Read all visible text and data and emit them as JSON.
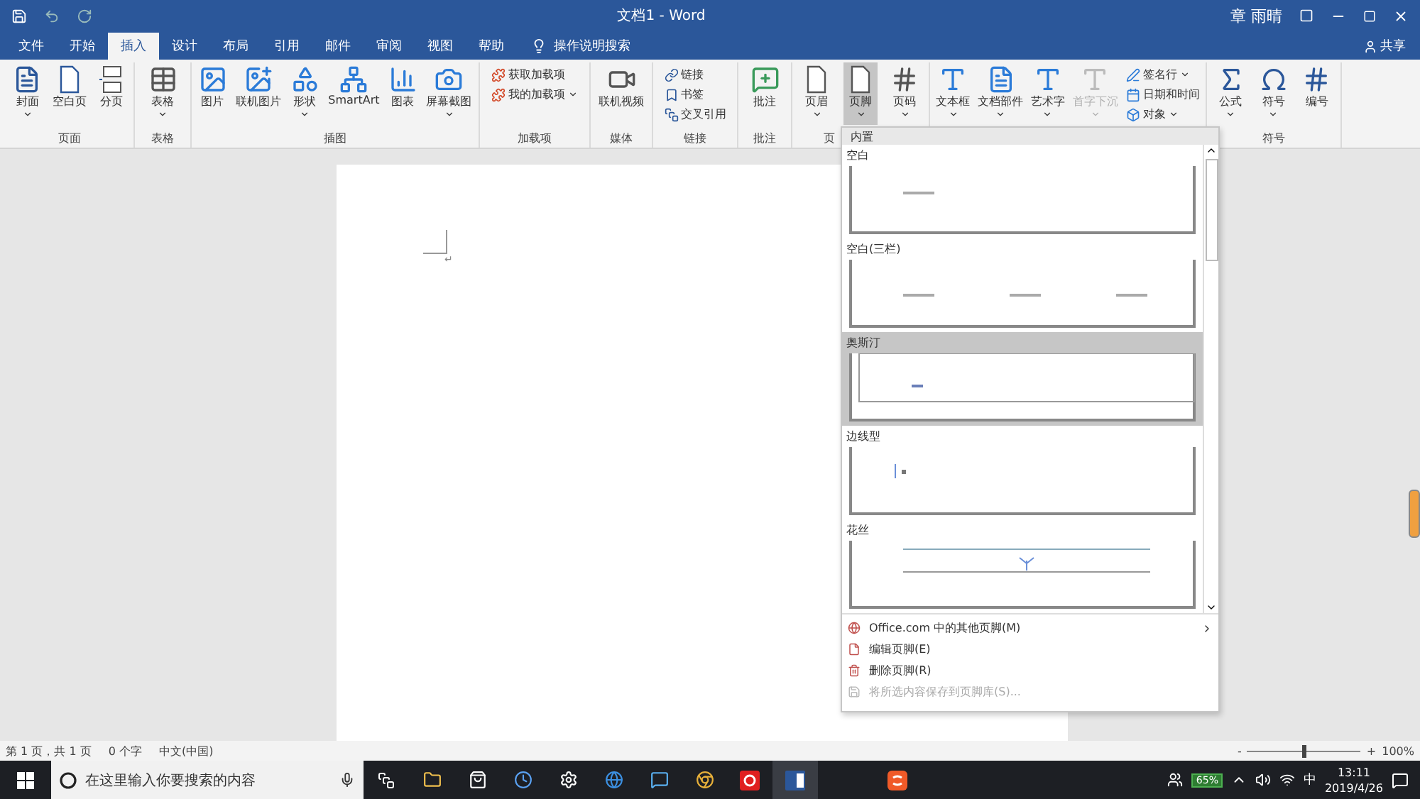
{
  "window": {
    "title": "文档1 - Word",
    "user": "章 雨晴",
    "share": "共享"
  },
  "tabs": [
    {
      "label": "文件",
      "selected": false
    },
    {
      "label": "开始",
      "selected": false
    },
    {
      "label": "插入",
      "selected": true
    },
    {
      "label": "设计",
      "selected": false
    },
    {
      "label": "布局",
      "selected": false
    },
    {
      "label": "引用",
      "selected": false
    },
    {
      "label": "邮件",
      "selected": false
    },
    {
      "label": "审阅",
      "selected": false
    },
    {
      "label": "视图",
      "selected": false
    },
    {
      "label": "帮助",
      "selected": false
    }
  ],
  "tell_me": "操作说明搜索",
  "ribbon": {
    "groups": [
      {
        "label": "页面",
        "buttons": [
          {
            "label": "封面",
            "kind": "large",
            "dropdown": true
          },
          {
            "label": "空白页",
            "kind": "large",
            "dropdown": false
          },
          {
            "label": "分页",
            "kind": "large",
            "dropdown": false
          }
        ]
      },
      {
        "label": "表格",
        "buttons": [
          {
            "label": "表格",
            "kind": "large",
            "dropdown": true
          }
        ]
      },
      {
        "label": "插图",
        "buttons": [
          {
            "label": "图片",
            "kind": "large",
            "dropdown": false
          },
          {
            "label": "联机图片",
            "kind": "large",
            "dropdown": false
          },
          {
            "label": "形状",
            "kind": "large",
            "dropdown": true
          },
          {
            "label": "SmartArt",
            "kind": "large",
            "dropdown": false
          },
          {
            "label": "图表",
            "kind": "large",
            "dropdown": false
          },
          {
            "label": "屏幕截图",
            "kind": "large",
            "dropdown": true
          }
        ]
      },
      {
        "label": "加载项",
        "buttons": [
          {
            "label": "获取加载项",
            "kind": "small",
            "dropdown": false
          },
          {
            "label": "我的加载项",
            "kind": "small",
            "dropdown": true
          }
        ]
      },
      {
        "label": "媒体",
        "buttons": [
          {
            "label": "联机视频",
            "kind": "large",
            "dropdown": false
          }
        ]
      },
      {
        "label": "链接",
        "buttons": [
          {
            "label": "链接",
            "kind": "small",
            "dropdown": false
          },
          {
            "label": "书签",
            "kind": "small",
            "dropdown": false
          },
          {
            "label": "交叉引用",
            "kind": "small",
            "dropdown": false
          }
        ]
      },
      {
        "label": "批注",
        "buttons": [
          {
            "label": "批注",
            "kind": "large",
            "dropdown": false
          }
        ]
      },
      {
        "label": "页",
        "buttons": [
          {
            "label": "页眉",
            "kind": "large",
            "dropdown": true,
            "selected": false
          },
          {
            "label": "页脚",
            "kind": "large",
            "dropdown": true,
            "selected": true
          },
          {
            "label": "页码",
            "kind": "large",
            "dropdown": true,
            "selected": false
          }
        ]
      },
      {
        "buttons": [
          {
            "label": "文本框",
            "kind": "large",
            "dropdown": true,
            "disabled": false
          },
          {
            "label": "文档部件",
            "kind": "large",
            "dropdown": true,
            "disabled": false
          },
          {
            "label": "艺术字",
            "kind": "large",
            "dropdown": true,
            "disabled": false
          },
          {
            "label": "首字下沉",
            "kind": "large",
            "dropdown": true,
            "disabled": true
          },
          {
            "label": "签名行",
            "kind": "small",
            "dropdown": true,
            "disabled": false
          },
          {
            "label": "日期和时间",
            "kind": "small",
            "dropdown": false,
            "disabled": false
          },
          {
            "label": "对象",
            "kind": "small",
            "dropdown": true,
            "disabled": false
          }
        ]
      },
      {
        "label": "符号",
        "buttons": [
          {
            "label": "公式",
            "kind": "large",
            "dropdown": true
          },
          {
            "label": "符号",
            "kind": "large",
            "dropdown": true
          },
          {
            "label": "编号",
            "kind": "large",
            "dropdown": false
          }
        ]
      }
    ]
  },
  "document": {
    "paragraph_mark": "↵"
  },
  "footer_menu": {
    "header": "内置",
    "gallery": [
      {
        "label": "空白",
        "kind": "blank",
        "selected": false
      },
      {
        "label": "空白(三栏)",
        "kind": "three",
        "selected": false
      },
      {
        "label": "奥斯汀",
        "kind": "austin",
        "selected": true
      },
      {
        "label": "边线型",
        "kind": "sideline",
        "selected": false
      },
      {
        "label": "花丝",
        "kind": "filigree",
        "selected": false
      }
    ],
    "commands": [
      {
        "label": "Office.com 中的其他页脚(M)",
        "submenu": true,
        "disabled": false
      },
      {
        "label": "编辑页脚(E)",
        "submenu": false,
        "disabled": false
      },
      {
        "label": "删除页脚(R)",
        "submenu": false,
        "disabled": false
      },
      {
        "label": "将所选内容保存到页脚库(S)...",
        "submenu": false,
        "disabled": true
      }
    ]
  },
  "status_bar": {
    "items": [
      "第 1 页，共 1 页",
      "0 个字",
      "中文(中国)"
    ],
    "zoom": {
      "level": 0.5,
      "minus": "-",
      "plus": "+",
      "reading": "100%"
    }
  },
  "taskbar": {
    "search_placeholder": "在这里输入你要搜索的内容",
    "battery": "65%",
    "ime": "中",
    "time": "13:11",
    "date": "2019/4/26"
  }
}
